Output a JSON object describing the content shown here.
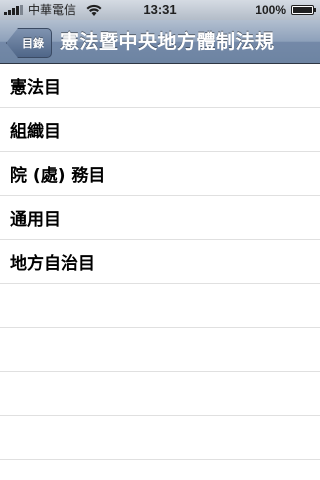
{
  "status_bar": {
    "carrier": "中華電信",
    "time": "13:31",
    "battery": "100%",
    "battery_level": 1.0,
    "signal_bars": 4,
    "icons": [
      "signal-icon",
      "wifi-icon",
      "battery-icon"
    ]
  },
  "nav": {
    "back_label": "目錄",
    "title": "憲法暨中央地方體制法規"
  },
  "list": {
    "items": [
      {
        "label": "憲法目"
      },
      {
        "label": "組織目"
      },
      {
        "label": "院 (處) 務目"
      },
      {
        "label": "通用目"
      },
      {
        "label": "地方自治目"
      }
    ]
  },
  "colors": {
    "nav_bar": "#7489a8",
    "status_bar": "#b3bcc8",
    "separator": "#e0e0e0"
  }
}
